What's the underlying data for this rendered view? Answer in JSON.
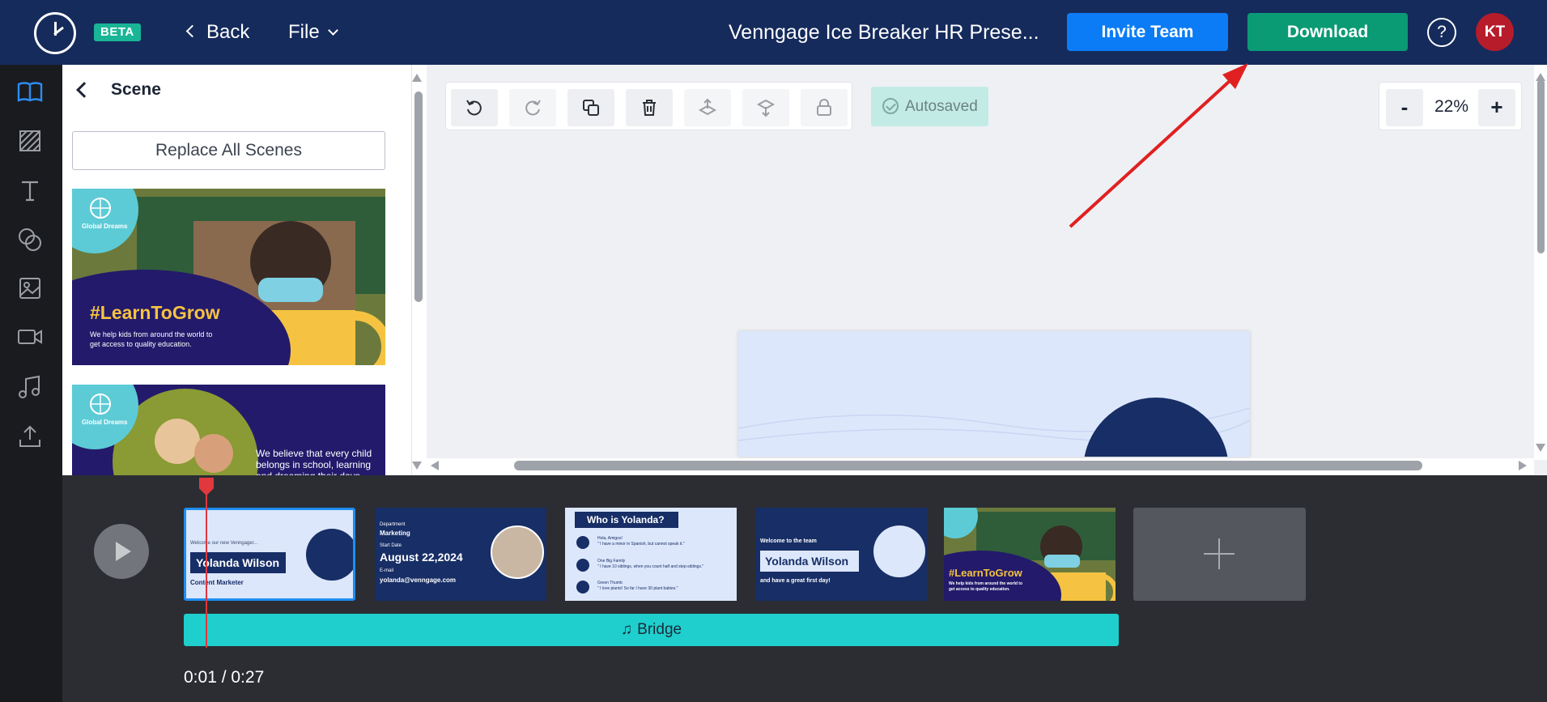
{
  "header": {
    "beta": "BETA",
    "back_label": "Back",
    "file_label": "File",
    "doc_title": "Venngage Ice Breaker HR Prese...",
    "invite_label": "Invite Team",
    "download_label": "Download",
    "help_label": "?",
    "avatar_initials": "KT"
  },
  "rail": {
    "items": [
      "book-icon",
      "pattern-icon",
      "text-icon",
      "shapes-icon",
      "image-icon",
      "video-icon",
      "music-icon",
      "upload-icon"
    ]
  },
  "panel": {
    "title": "Scene",
    "replace_label": "Replace All Scenes",
    "scene1": {
      "brand": "Global Dreams",
      "hashtag": "#LearnToGrow",
      "body": "We help kids from around the world to get access to quality education."
    },
    "scene2": {
      "brand": "Global Dreams",
      "body": "We believe that every child belongs in school, learning and dreaming their days"
    }
  },
  "toolbar": {
    "tools": [
      "undo-icon",
      "redo-icon",
      "duplicate-icon",
      "delete-icon",
      "bring-forward-icon",
      "send-backward-icon",
      "lock-icon"
    ],
    "autosaved_label": "Autosaved"
  },
  "zoom": {
    "minus": "-",
    "value": "22%",
    "plus": "+"
  },
  "timeline": {
    "clips": [
      {
        "welcome": "Welcome our new Venngager...",
        "name": "Yolanda Wilson",
        "role": "Content Marketer"
      },
      {
        "dept_label": "Department",
        "dept": "Marketing",
        "start_label": "Start Date",
        "date": "August 22,2024",
        "email_label": "E-mail",
        "email": "yolanda@venngage.com"
      },
      {
        "title": "Who is Yolanda?",
        "line1a": "Hola, Amigos!",
        "line1b": "\" I have a minor in Spanish, but cannot speak it.\"",
        "line2a": "One Big Family",
        "line2b": "\" I have 10 siblings, when you count half and step-siblings.\"",
        "line3a": "Green Thumb",
        "line3b": "\" I love plants! So far I have 30 plant babies.\""
      },
      {
        "welcome": "Welcome to the team",
        "name": "Yolanda Wilson",
        "tagline": "and have a great first day!"
      },
      {
        "hashtag": "#LearnToGrow",
        "body": "We help kids from around the world to get access to quality education."
      }
    ],
    "audio_label": "Bridge",
    "timecode": "0:01 / 0:27"
  },
  "colors": {
    "topbar": "#152b5c",
    "invite": "#0b7cf5",
    "download": "#0a9a74",
    "annotation": "#e02020"
  }
}
